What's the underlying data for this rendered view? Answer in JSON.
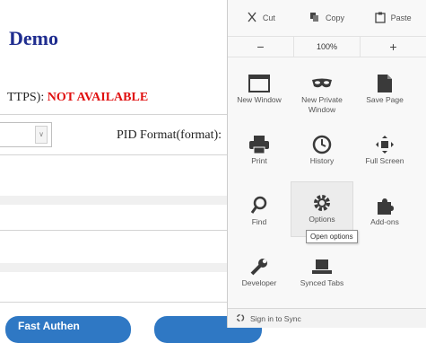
{
  "page": {
    "title": "Demo",
    "status_label": "TTPS):",
    "status_value": "NOT AVAILABLE",
    "pid_label": "PID Format(format):",
    "button_1_label": "Fast Authen",
    "button_2_label": ""
  },
  "menu": {
    "edit": {
      "cut": "Cut",
      "copy": "Copy",
      "paste": "Paste"
    },
    "zoom": {
      "minus": "−",
      "level": "100%",
      "plus": "+"
    },
    "items": [
      {
        "label": "New Window",
        "icon": "new-window-icon"
      },
      {
        "label": "New Private Window",
        "icon": "private-mask-icon"
      },
      {
        "label": "Save Page",
        "icon": "save-page-icon"
      },
      {
        "label": "Print",
        "icon": "printer-icon"
      },
      {
        "label": "History",
        "icon": "clock-icon"
      },
      {
        "label": "Full Screen",
        "icon": "fullscreen-icon"
      },
      {
        "label": "Find",
        "icon": "magnifier-icon"
      },
      {
        "label": "Options",
        "icon": "gear-icon"
      },
      {
        "label": "Add-ons",
        "icon": "puzzle-icon"
      },
      {
        "label": "Developer",
        "icon": "wrench-icon"
      },
      {
        "label": "Synced Tabs",
        "icon": "synced-tabs-icon"
      }
    ],
    "tooltip": "Open options",
    "footer": "Sign in to Sync"
  },
  "colors": {
    "title_blue": "#1f2d8f",
    "status_red": "#e01010",
    "button_blue": "#2f78c4",
    "icon_dark": "#3a3a3a"
  }
}
